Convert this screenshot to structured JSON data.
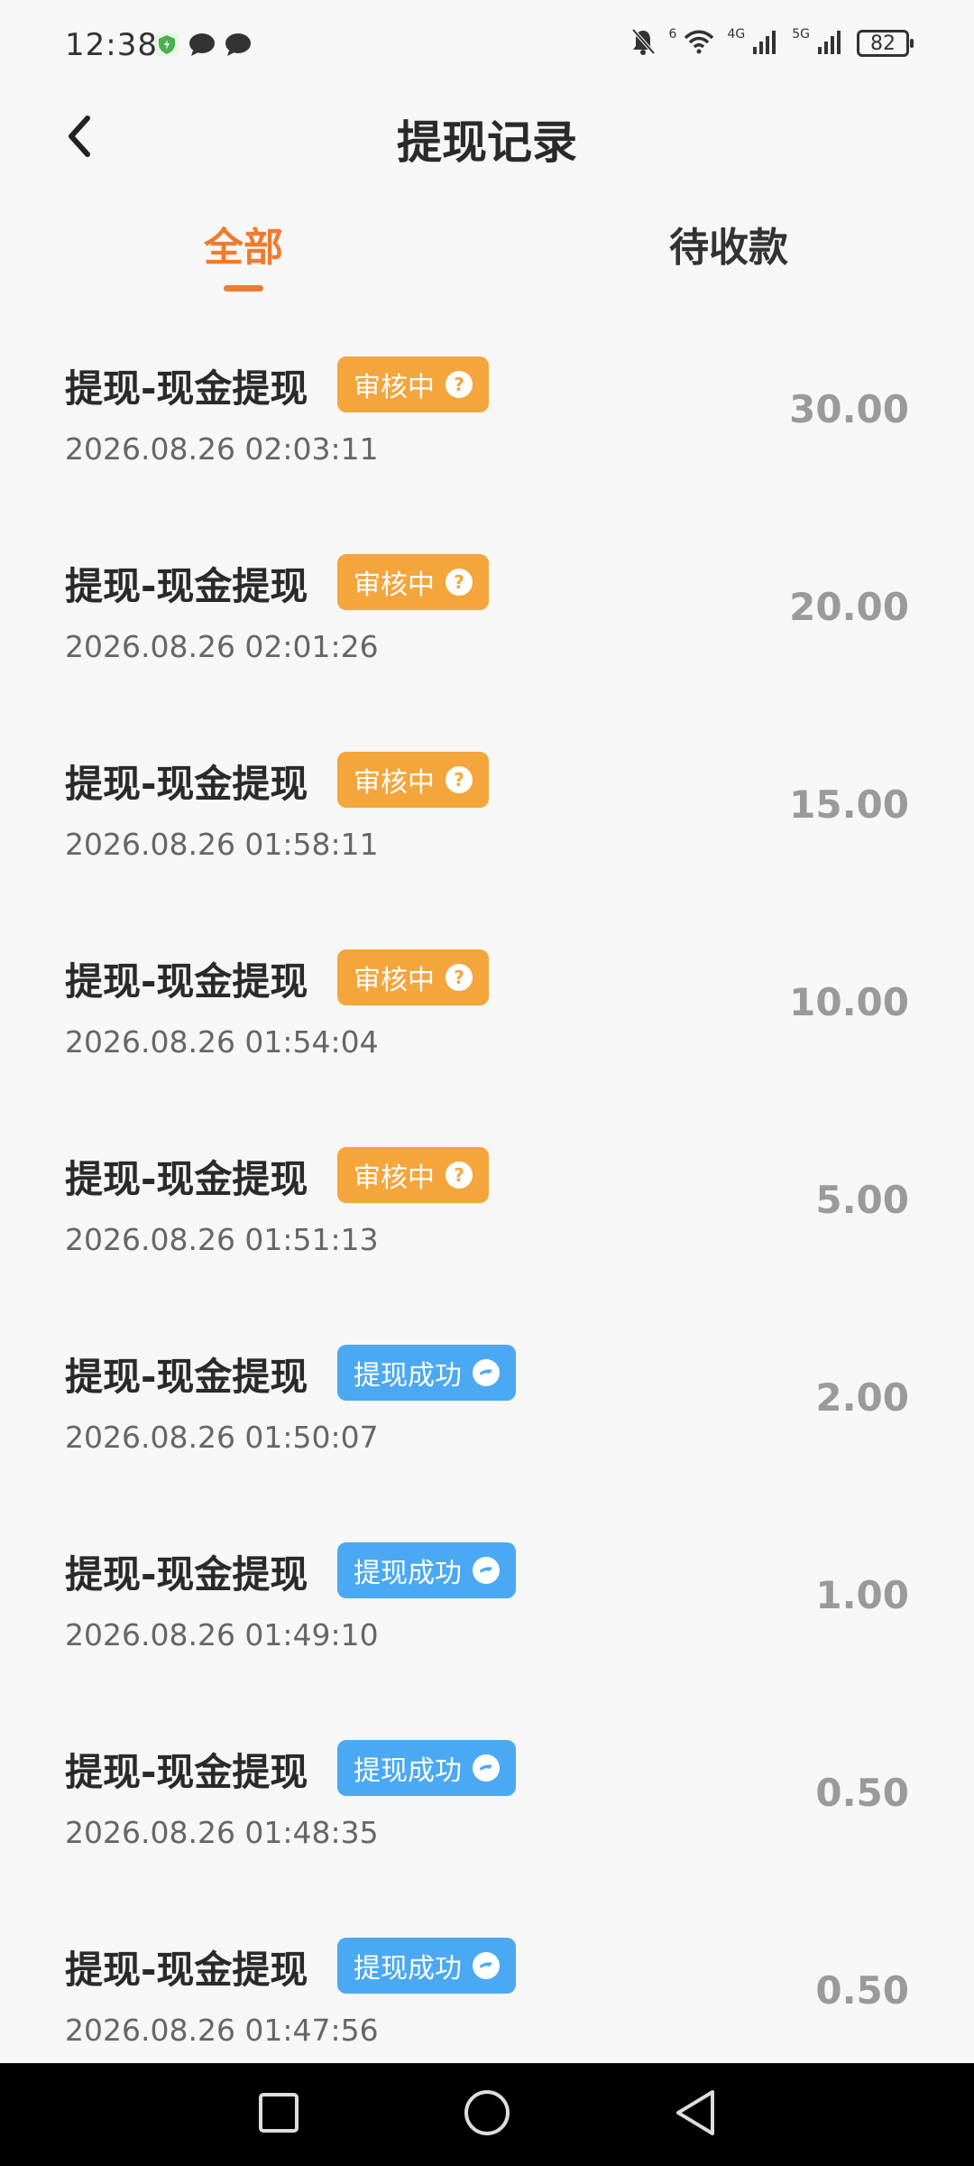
{
  "status_bar": {
    "time": "12:38",
    "battery": "82",
    "wifi_label": "6",
    "sim1_label": "4G",
    "sim2_label": "5G"
  },
  "header": {
    "title": "提现记录"
  },
  "tabs": [
    {
      "label": "全部",
      "active": true
    },
    {
      "label": "待收款",
      "active": false
    }
  ],
  "records": [
    {
      "title": "提现-现金提现",
      "status": "审核中",
      "status_type": "review",
      "time": "2026.08.26 02:03:11",
      "amount": "30.00"
    },
    {
      "title": "提现-现金提现",
      "status": "审核中",
      "status_type": "review",
      "time": "2026.08.26 02:01:26",
      "amount": "20.00"
    },
    {
      "title": "提现-现金提现",
      "status": "审核中",
      "status_type": "review",
      "time": "2026.08.26 01:58:11",
      "amount": "15.00"
    },
    {
      "title": "提现-现金提现",
      "status": "审核中",
      "status_type": "review",
      "time": "2026.08.26 01:54:04",
      "amount": "10.00"
    },
    {
      "title": "提现-现金提现",
      "status": "审核中",
      "status_type": "review",
      "time": "2026.08.26 01:51:13",
      "amount": "5.00"
    },
    {
      "title": "提现-现金提现",
      "status": "提现成功",
      "status_type": "success",
      "time": "2026.08.26 01:50:07",
      "amount": "2.00"
    },
    {
      "title": "提现-现金提现",
      "status": "提现成功",
      "status_type": "success",
      "time": "2026.08.26 01:49:10",
      "amount": "1.00"
    },
    {
      "title": "提现-现金提现",
      "status": "提现成功",
      "status_type": "success",
      "time": "2026.08.26 01:48:35",
      "amount": "0.50"
    },
    {
      "title": "提现-现金提现",
      "status": "提现成功",
      "status_type": "success",
      "time": "2026.08.26 01:47:56",
      "amount": "0.50"
    }
  ],
  "colors": {
    "accent": "#ef7b30",
    "review_badge": "#f4a53b",
    "success_badge": "#4aa9f2",
    "amount_text": "#9a9a9a"
  },
  "icons": {
    "review": "question-circle-icon",
    "success": "chat-bubble-icon"
  }
}
